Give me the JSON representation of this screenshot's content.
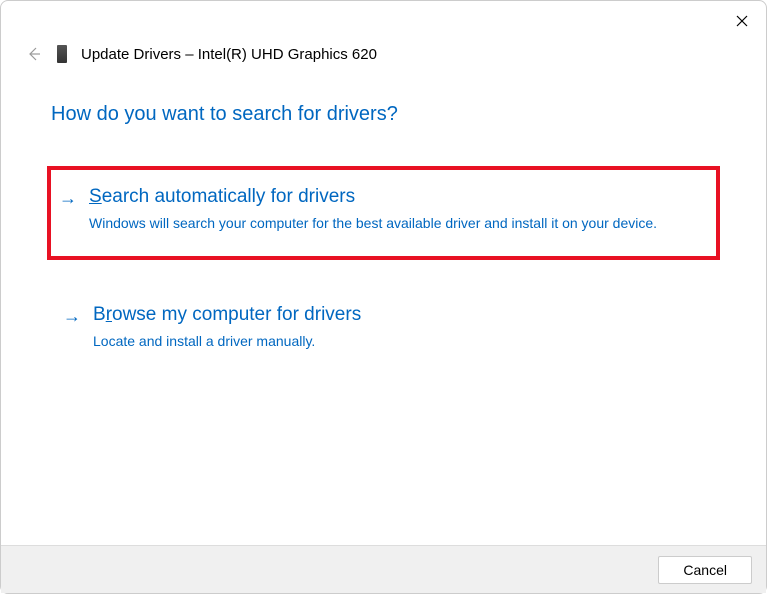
{
  "header": {
    "title": "Update Drivers – Intel(R) UHD Graphics 620"
  },
  "question": "How do you want to search for drivers?",
  "options": [
    {
      "title_prefix": "S",
      "title_rest": "earch automatically for drivers",
      "description": "Windows will search your computer for the best available driver and install it on your device."
    },
    {
      "title_prefix": "B",
      "title_mid": "r",
      "title_rest": "owse my computer for drivers",
      "description": "Locate and install a driver manually."
    }
  ],
  "footer": {
    "cancel": "Cancel"
  }
}
